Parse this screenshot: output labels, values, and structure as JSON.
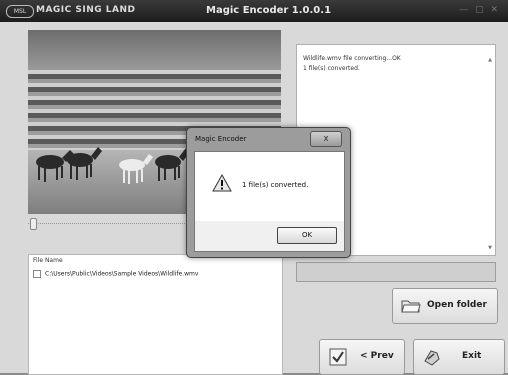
{
  "titlebar": {
    "brand": "MAGIC SING LAND",
    "title": "Magic Encoder 1.0.0.1",
    "logo_text": "MSL"
  },
  "video": {
    "progress_fraction": 0.0
  },
  "filelist": {
    "header": "File Name",
    "rows": [
      "C:\\Users\\Public\\Videos\\Sample Videos\\Wildlife.wmv"
    ]
  },
  "log": {
    "lines": [
      "Wildlife.wmv file converting...OK",
      "1 file(s) converted."
    ]
  },
  "conversion_progress_fraction": 0.0,
  "buttons": {
    "open_folder": "Open folder",
    "prev": "< Prev",
    "exit": "Exit"
  },
  "dialog": {
    "title": "Magic Encoder",
    "close": "X",
    "message": "1 file(s) converted.",
    "ok": "OK"
  },
  "icons": {
    "warning": "warning-icon",
    "folder": "folder-icon",
    "check": "check-icon",
    "exit": "exit-icon"
  }
}
